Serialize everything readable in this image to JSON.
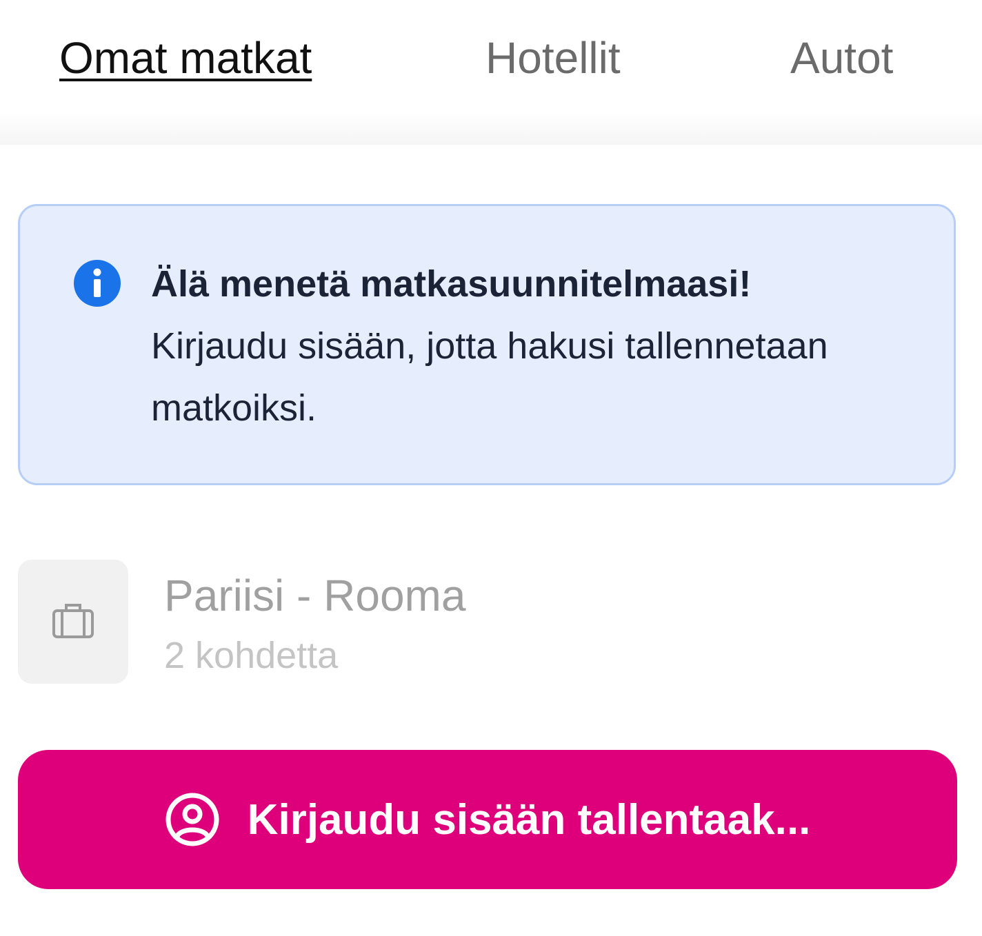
{
  "tabs": [
    {
      "label": "Omat matkat",
      "active": true
    },
    {
      "label": "Hotellit",
      "active": false
    },
    {
      "label": "Autot",
      "active": false
    }
  ],
  "alert": {
    "icon": "info-icon",
    "title": "Älä menetä matkasuunnitelmaasi!",
    "body": "Kirjaudu sisään, jotta hakusi tallennetaan matkoiksi.",
    "background_color": "#e6eefd",
    "border_color": "#b6cdf6",
    "icon_color": "#1a73e8"
  },
  "trip": {
    "icon": "suitcase-icon",
    "title": "Pariisi - Rooma",
    "subtitle": "2 kohdetta"
  },
  "login_button": {
    "icon": "user-circle-icon",
    "label": "Kirjaudu sisään tallentaak...",
    "color": "#de007a"
  }
}
